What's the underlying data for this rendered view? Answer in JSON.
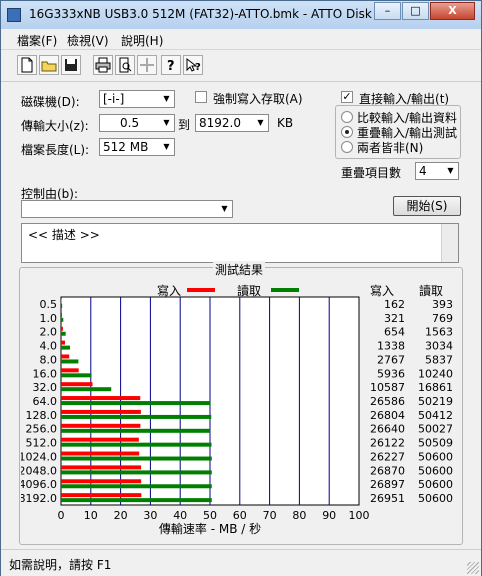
{
  "window": {
    "title": "16G333xNB USB3.0 512M (FAT32)-ATTO.bmk - ATTO Disk ..."
  },
  "window_buttons": {
    "minimize": "–",
    "maximize": "□",
    "close": "X"
  },
  "menu": {
    "file": "檔案(F)",
    "view": "檢視(V)",
    "help": "說明(H)"
  },
  "toolbar_icons": [
    "new-icon",
    "open-icon",
    "save-icon",
    "print-icon",
    "print-preview-icon",
    "move-icon",
    "help-icon",
    "context-help-icon"
  ],
  "controls": {
    "drive_label": "磁碟機(D):",
    "drive_value": "[-i-]",
    "transfer_size_label": "傳輸大小(z):",
    "transfer_from": "0.5",
    "to_label": "到",
    "transfer_to": "8192.0",
    "kb_label": "KB",
    "file_length_label": "檔案長度(L):",
    "file_length_value": "512 MB",
    "force_write_label": "強制寫入存取(A)",
    "direct_io_label": "直接輸入/輸出(t)",
    "direct_io_checked": true,
    "radio_compare": "比較輸入/輸出資料",
    "radio_overlap": "重疊輸入/輸出測試",
    "radio_neither": "兩者皆非(N)",
    "queue_label": "重疊項目數",
    "queue_value": "4",
    "controlled_by_label": "控制由(b):",
    "start_button": "開始(S)",
    "description": "<<    描述    >>"
  },
  "results": {
    "title": "測試結果",
    "legend_write": "寫入",
    "legend_read": "讀取",
    "col_write": "寫入",
    "col_read": "讀取"
  },
  "chart_data": {
    "type": "bar",
    "orientation": "horizontal",
    "categories": [
      "0.5",
      "1.0",
      "2.0",
      "4.0",
      "8.0",
      "16.0",
      "32.0",
      "64.0",
      "128.0",
      "256.0",
      "512.0",
      "1024.0",
      "2048.0",
      "4096.0",
      "8192.0"
    ],
    "series": [
      {
        "name": "寫入",
        "color": "#ff0000",
        "values": [
          162,
          321,
          654,
          1338,
          2767,
          5936,
          10587,
          26586,
          26804,
          26640,
          26122,
          26227,
          26870,
          26897,
          26951
        ]
      },
      {
        "name": "讀取",
        "color": "#008000",
        "values": [
          393,
          769,
          1563,
          3034,
          5837,
          10240,
          16861,
          50219,
          50412,
          50027,
          50509,
          50600,
          50600,
          50600,
          50600
        ]
      }
    ],
    "xlabel": "傳輸速率 - MB / 秒",
    "xlim": [
      0,
      100
    ],
    "xticks": [
      "0",
      "10",
      "20",
      "30",
      "40",
      "50",
      "60",
      "70",
      "80",
      "90",
      "100"
    ],
    "grid": true
  },
  "status": {
    "text": "如需說明，請按 F1"
  }
}
